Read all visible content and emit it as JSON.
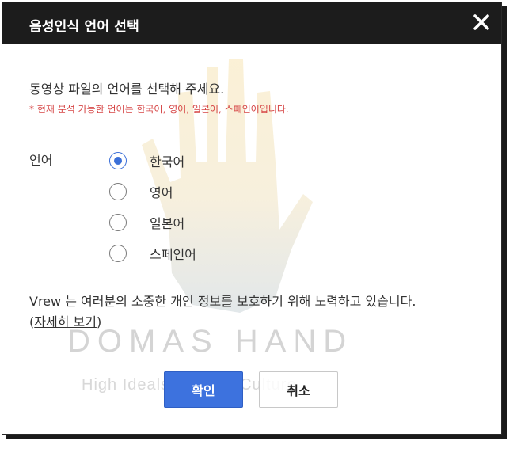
{
  "dialog": {
    "title": "음성인식 언어 선택",
    "close_icon": "close-icon"
  },
  "content": {
    "instruction": "동영상 파일의 언어를 선택해 주세요.",
    "note": "* 현재 분석 가능한 언어는 한국어, 영어, 일본어, 스페인어입니다.",
    "language_label": "언어",
    "options": [
      {
        "label": "한국어",
        "selected": true
      },
      {
        "label": "영어",
        "selected": false
      },
      {
        "label": "일본어",
        "selected": false
      },
      {
        "label": "스페인어",
        "selected": false
      }
    ],
    "privacy_text": "Vrew 는 여러분의 소중한 개인 정보를 보호하기 위해 노력하고 있습니다.",
    "details_open": "(",
    "details_link": "자세히 보기",
    "details_close": ")"
  },
  "buttons": {
    "confirm": "확인",
    "cancel": "취소"
  },
  "watermark": {
    "title": "DOMAS HAND",
    "subtitle": "High Ideals & Great Culture"
  },
  "colors": {
    "titlebar": "#1c1c1c",
    "accent": "#3d72de",
    "note": "#d64545"
  }
}
